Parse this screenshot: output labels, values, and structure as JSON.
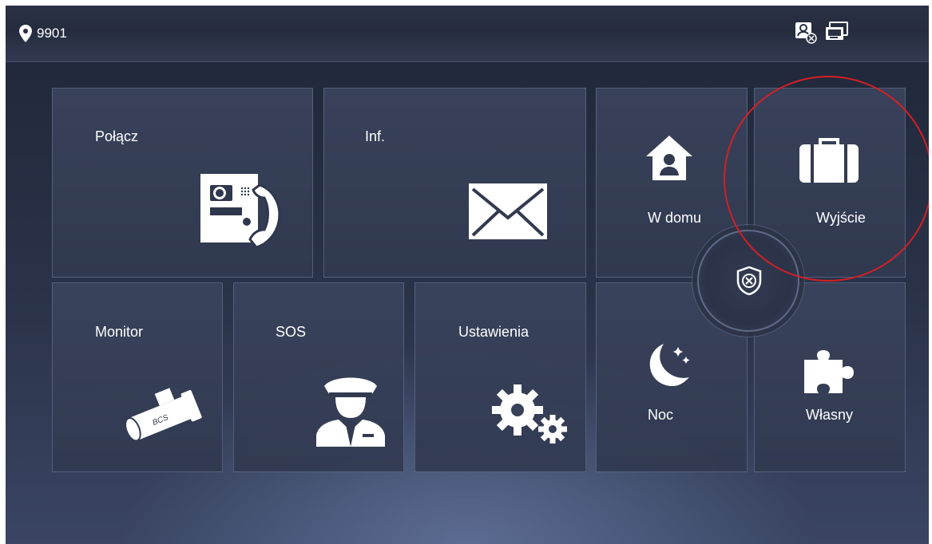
{
  "topbar": {
    "room_number": "9901"
  },
  "tiles": {
    "call": {
      "label": "Połącz"
    },
    "info": {
      "label": "Inf."
    },
    "home": {
      "label": "W domu"
    },
    "away": {
      "label": "Wyjście"
    },
    "monitor": {
      "label": "Monitor",
      "logo": "BCS"
    },
    "sos": {
      "label": "SOS"
    },
    "settings": {
      "label": "Ustawienia"
    },
    "night": {
      "label": "Noc"
    },
    "custom": {
      "label": "Własny"
    }
  },
  "icons": {
    "location": "location-pin-icon",
    "contact": "contact-status-icon",
    "monitor_status": "screen-status-icon",
    "disarm": "shield-disarm-icon"
  },
  "colors": {
    "highlight": "#d31f26",
    "text": "#ffffff"
  }
}
